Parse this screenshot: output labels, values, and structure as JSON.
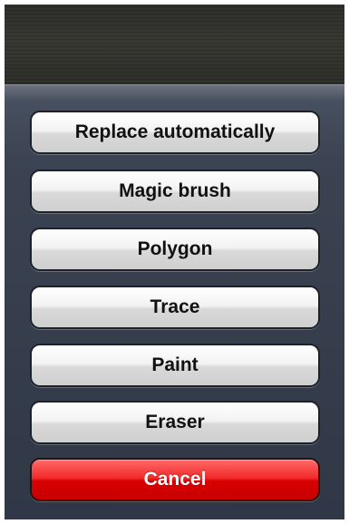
{
  "action_sheet": {
    "buttons": [
      {
        "label": "Replace automatically"
      },
      {
        "label": "Magic brush"
      },
      {
        "label": "Polygon"
      },
      {
        "label": "Trace"
      },
      {
        "label": "Paint"
      },
      {
        "label": "Eraser"
      }
    ],
    "cancel_label": "Cancel"
  },
  "colors": {
    "sheet_background": "#3b4352",
    "cancel_red": "#e00000",
    "button_text": "#111111"
  }
}
